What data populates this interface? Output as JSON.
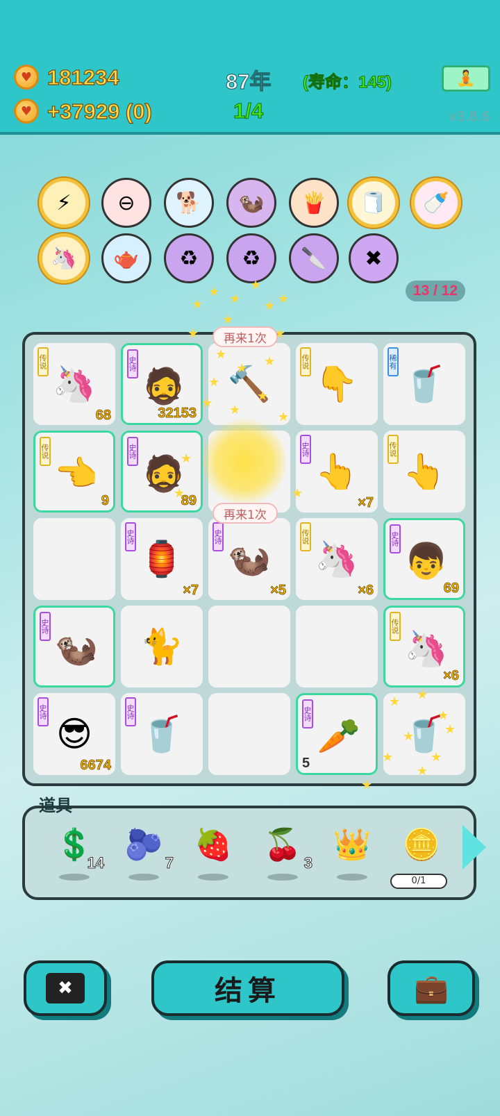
{
  "header": {
    "gold": "181234",
    "income": "+37929 (0)",
    "year": "87年",
    "lifespan": "(寿命：145)",
    "round": "1/4",
    "version": "v3.8.6"
  },
  "skills_counter": "13 / 12",
  "skills": [
    {
      "name": "lightning-icon",
      "glyph": "⚡"
    },
    {
      "name": "minus-icon",
      "glyph": "⊖"
    },
    {
      "name": "dog-icon",
      "glyph": "🐕"
    },
    {
      "name": "otters-icon",
      "glyph": "🦦"
    },
    {
      "name": "fries-icon",
      "glyph": "🍟"
    },
    {
      "name": "tissue-box-icon",
      "glyph": "🧻"
    },
    {
      "name": "breast-pump-icon",
      "glyph": "🍼"
    },
    {
      "name": "unicorn-icon",
      "glyph": "🦄"
    },
    {
      "name": "gravy-boat-icon",
      "glyph": "🫖"
    },
    {
      "name": "recycle-icon",
      "glyph": "♻"
    },
    {
      "name": "recycle-icon",
      "glyph": "♻"
    },
    {
      "name": "cleaver-icon",
      "glyph": "🔪"
    },
    {
      "name": "delete-icon",
      "glyph": "✖"
    }
  ],
  "board": [
    {
      "tag": "传说",
      "tagType": "legend",
      "glyph": "🦄",
      "num": "68",
      "icon": "unicorn-icon"
    },
    {
      "tag": "史诗",
      "tagType": "epic",
      "glyph": "🧔",
      "num": "32153",
      "icon": "bald-man-icon",
      "glow": true
    },
    {
      "tag": "",
      "tagType": "",
      "glyph": "🔨",
      "num": "",
      "icon": "hammer-icon"
    },
    {
      "tag": "传说",
      "tagType": "legend",
      "glyph": "👇",
      "num": "",
      "icon": "pointing-finger-icon"
    },
    {
      "tag": "稀有",
      "tagType": "rare",
      "glyph": "🥤",
      "num": "",
      "icon": "milk-tea-icon"
    },
    {
      "tag": "传说",
      "tagType": "legend",
      "glyph": "👈",
      "num": "9",
      "icon": "pointing-finger-icon",
      "glow": true
    },
    {
      "tag": "史诗",
      "tagType": "epic",
      "glyph": "🧔",
      "num": "89",
      "icon": "bald-man-icon",
      "glow": true
    },
    {
      "tag": "",
      "tagType": "",
      "glyph": "",
      "num": "",
      "icon": "star-burst-icon"
    },
    {
      "tag": "史诗",
      "tagType": "epic",
      "glyph": "👆",
      "num": "×7",
      "icon": "pointing-finger-icon"
    },
    {
      "tag": "传说",
      "tagType": "legend",
      "glyph": "👆",
      "num": "",
      "icon": "pointing-finger-icon"
    },
    {
      "tag": "",
      "tagType": "",
      "glyph": "",
      "num": "",
      "icon": ""
    },
    {
      "tag": "史诗",
      "tagType": "epic",
      "glyph": "🏮",
      "num": "×7",
      "icon": "rabbit-house-icon"
    },
    {
      "tag": "史诗",
      "tagType": "epic",
      "glyph": "🦦",
      "num": "×5",
      "icon": "otter-icon"
    },
    {
      "tag": "传说",
      "tagType": "legend",
      "glyph": "🦄",
      "num": "×6",
      "icon": "unicorn-icon"
    },
    {
      "tag": "史诗",
      "tagType": "epic",
      "glyph": "👦",
      "num": "69",
      "icon": "boy-red-cap-icon",
      "glow": true
    },
    {
      "tag": "史诗",
      "tagType": "epic",
      "glyph": "🦦",
      "num": "",
      "icon": "otter-icon",
      "glow": true
    },
    {
      "tag": "",
      "tagType": "",
      "glyph": "🐈",
      "num": "",
      "icon": "cat-icon"
    },
    {
      "tag": "",
      "tagType": "",
      "glyph": "",
      "num": "",
      "icon": ""
    },
    {
      "tag": "",
      "tagType": "",
      "glyph": "",
      "num": "",
      "icon": ""
    },
    {
      "tag": "传说",
      "tagType": "legend",
      "glyph": "🦄",
      "num": "×6",
      "icon": "unicorn-icon",
      "glow": true
    },
    {
      "tag": "史诗",
      "tagType": "epic",
      "glyph": "😎",
      "num": "6674",
      "icon": "sunglasses-man-icon"
    },
    {
      "tag": "史诗",
      "tagType": "epic",
      "glyph": "🥤",
      "num": "",
      "icon": "milk-tea-icon"
    },
    {
      "tag": "",
      "tagType": "",
      "glyph": "",
      "num": "",
      "icon": ""
    },
    {
      "tag": "史诗",
      "tagType": "epic",
      "glyph": "🥕",
      "num": "5",
      "numLeft": true,
      "numDark": true,
      "icon": "carrot-icon",
      "glow": true
    },
    {
      "tag": "",
      "tagType": "",
      "glyph": "🥤",
      "num": "",
      "icon": "milk-tea-icon"
    }
  ],
  "bubbles": [
    "再来1次",
    "再来1次"
  ],
  "props": {
    "title": "道具",
    "items": [
      {
        "icon": "dollar-coin-icon",
        "glyph": "💲",
        "count": "14"
      },
      {
        "icon": "blueberry-icon",
        "glyph": "🫐",
        "count": "7"
      },
      {
        "icon": "strawberry-icon",
        "glyph": "🍓",
        "count": ""
      },
      {
        "icon": "bayberry-icon",
        "glyph": "🍒",
        "count": "3"
      },
      {
        "icon": "crown-icon",
        "glyph": "👑",
        "count": ""
      },
      {
        "icon": "coin-stack-icon",
        "glyph": "🪙",
        "count": "",
        "progress": "0/1"
      }
    ]
  },
  "buttons": {
    "delete": "✖",
    "settle": "结算",
    "bag": "💼"
  }
}
